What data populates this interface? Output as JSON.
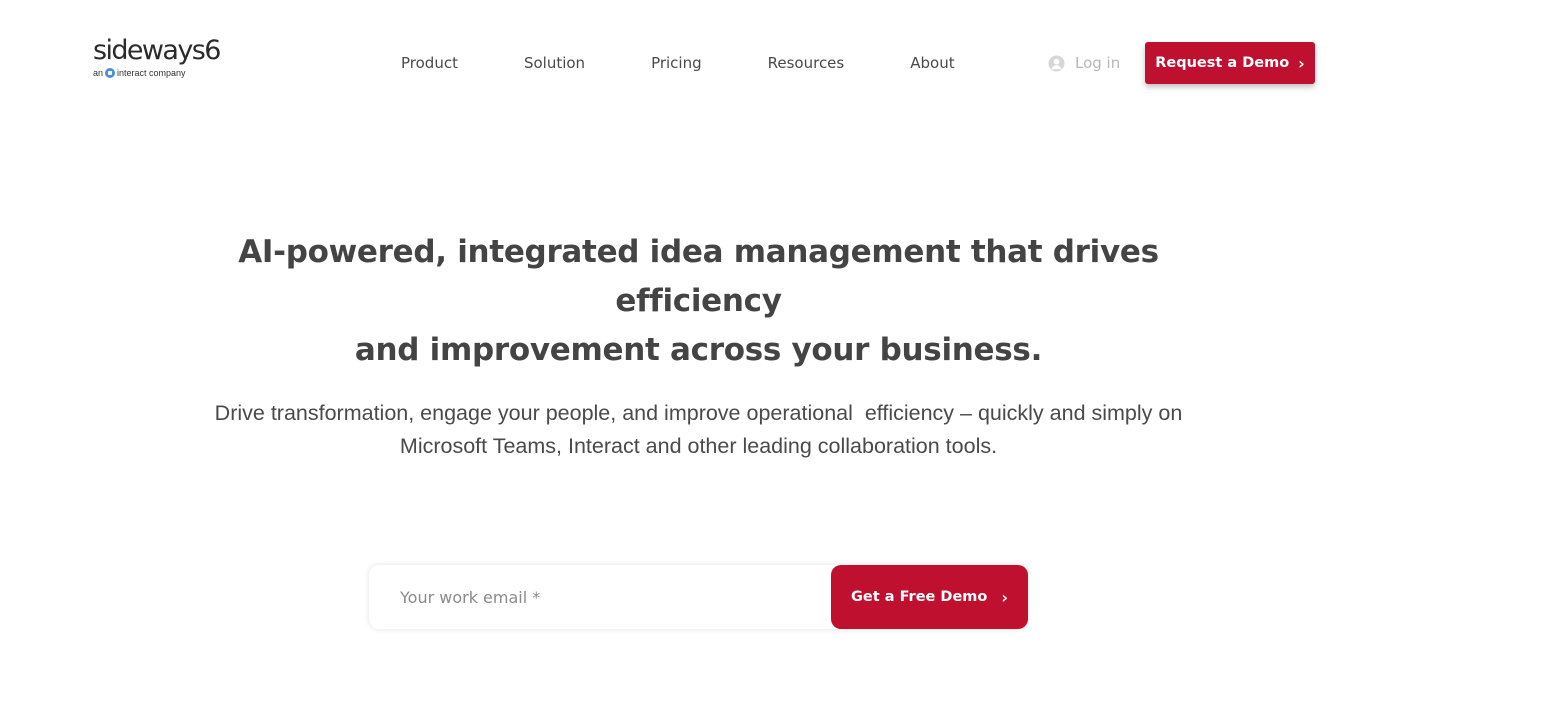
{
  "brand": {
    "name": "sideways6",
    "tagline_prefix": "an",
    "tagline_suffix": "interact company"
  },
  "nav": {
    "items": [
      {
        "label": "Product"
      },
      {
        "label": "Solution"
      },
      {
        "label": "Pricing"
      },
      {
        "label": "Resources"
      },
      {
        "label": "About"
      }
    ]
  },
  "header": {
    "login_label": "Log in",
    "login_icon": "user-circle-icon",
    "demo_button_label": "Request a Demo",
    "demo_button_chevron": "›"
  },
  "hero": {
    "headline_line1": "AI-powered, integrated idea management that drives efficiency",
    "headline_line2": "and improvement across your business.",
    "subtext_line1": "Drive transformation, engage your people, and improve operational  efficiency – quickly and simply on",
    "subtext_line2": "Microsoft Teams, Interact and other leading collaboration tools."
  },
  "signup": {
    "email_placeholder": "Your work email *",
    "email_value": "",
    "submit_label": "Get a Free Demo",
    "submit_chevron": "›"
  },
  "colors": {
    "accent": "#c0102f",
    "text": "#4a4a4a",
    "muted": "#b8b8b8",
    "background": "#ffffff"
  }
}
